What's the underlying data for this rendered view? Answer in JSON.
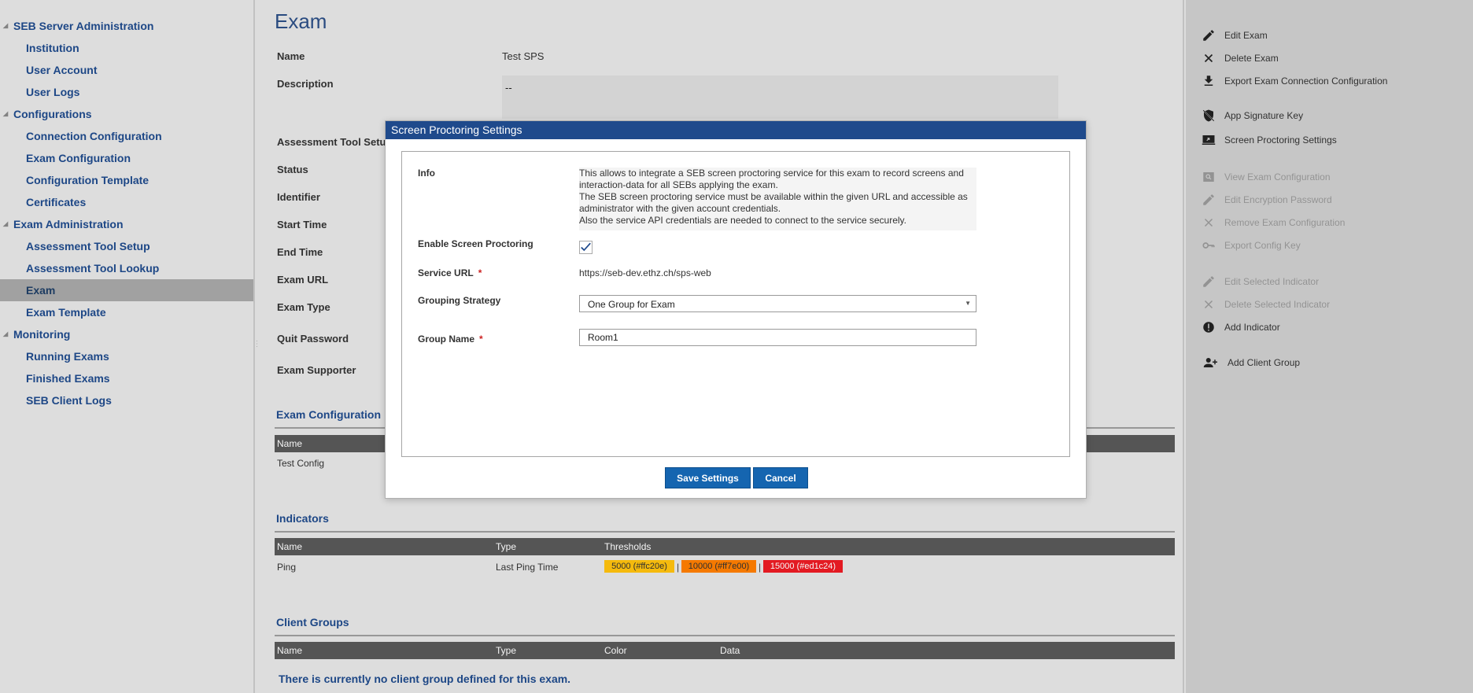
{
  "nav": {
    "groups": [
      {
        "label": "SEB Server Administration",
        "items": [
          "Institution",
          "User Account",
          "User Logs"
        ]
      },
      {
        "label": "Configurations",
        "items": [
          "Connection Configuration",
          "Exam Configuration",
          "Configuration Template",
          "Certificates"
        ]
      },
      {
        "label": "Exam Administration",
        "items": [
          "Assessment Tool Setup",
          "Assessment Tool Lookup",
          "Exam",
          "Exam Template"
        ]
      },
      {
        "label": "Monitoring",
        "items": [
          "Running Exams",
          "Finished Exams",
          "SEB Client Logs"
        ]
      }
    ],
    "active_item": "Exam"
  },
  "main": {
    "title": "Exam",
    "fields": {
      "name_label": "Name",
      "name_value": "Test SPS",
      "description_label": "Description",
      "description_value": "--",
      "assessment_tool_label": "Assessment Tool Setup",
      "status_label": "Status",
      "identifier_label": "Identifier",
      "start_time_label": "Start Time",
      "end_time_label": "End Time",
      "exam_url_label": "Exam URL",
      "exam_type_label": "Exam Type",
      "quit_password_label": "Quit Password",
      "exam_supporter_label": "Exam Supporter"
    },
    "exam_configuration": {
      "title": "Exam Configuration",
      "columns": [
        "Name"
      ],
      "rows": [
        [
          "Test Config"
        ]
      ]
    },
    "indicators": {
      "title": "Indicators",
      "columns": [
        "Name",
        "Type",
        "Thresholds"
      ],
      "rows": [
        {
          "name": "Ping",
          "type": "Last Ping Time",
          "thresholds": [
            {
              "label": "5000 (#ffc20e)",
              "color": "#ffc20e"
            },
            {
              "label": "10000 (#ff7e00)",
              "color": "#ff7e00"
            },
            {
              "label": "15000 (#ed1c24)",
              "color": "#ed1c24"
            }
          ],
          "separator": "|"
        }
      ]
    },
    "client_groups": {
      "title": "Client Groups",
      "columns": [
        "Name",
        "Type",
        "Color",
        "Data"
      ],
      "empty_message": "There is currently no client group defined for this exam."
    }
  },
  "actions": {
    "items": [
      {
        "label": "Edit Exam",
        "icon": "pencil-icon",
        "enabled": true
      },
      {
        "label": "Delete Exam",
        "icon": "close-icon",
        "enabled": true
      },
      {
        "label": "Export Exam Connection Configuration",
        "icon": "download-icon",
        "enabled": true
      },
      {
        "label": "App Signature Key",
        "icon": "shield-off-icon",
        "enabled": true
      },
      {
        "label": "Screen Proctoring Settings",
        "icon": "screen-share-icon",
        "enabled": true
      },
      {
        "label": "View Exam Configuration",
        "icon": "view-icon",
        "enabled": false
      },
      {
        "label": "Edit Encryption Password",
        "icon": "pencil-icon",
        "enabled": false
      },
      {
        "label": "Remove Exam Configuration",
        "icon": "close-icon",
        "enabled": false
      },
      {
        "label": "Export Config Key",
        "icon": "key-icon",
        "enabled": false
      },
      {
        "label": "Edit Selected Indicator",
        "icon": "pencil-icon",
        "enabled": false
      },
      {
        "label": "Delete Selected Indicator",
        "icon": "close-icon",
        "enabled": false
      },
      {
        "label": "Add Indicator",
        "icon": "alert-circle-icon",
        "enabled": true
      },
      {
        "label": "Add Client Group",
        "icon": "add-user-icon",
        "enabled": true
      }
    ]
  },
  "dialog": {
    "title": "Screen Proctoring Settings",
    "info_label": "Info",
    "info_lines": [
      "This allows to integrate a SEB screen proctoring service for this exam to record screens and",
      "interaction-data for all SEBs applying the exam.",
      "The SEB screen proctoring service must be available within the given URL and accessible as",
      "administrator with the given account credentials.",
      "Also the service API credentials are needed to connect to the service securely."
    ],
    "enable_label": "Enable Screen Proctoring",
    "enable_checked": true,
    "service_url_label": "Service URL",
    "service_url_value": "https://seb-dev.ethz.ch/sps-web",
    "grouping_label": "Grouping Strategy",
    "grouping_value": "One Group for Exam",
    "group_name_label": "Group Name",
    "group_name_value": "Room1",
    "required_mark": "*",
    "save_label": "Save Settings",
    "cancel_label": "Cancel"
  },
  "colors": {
    "primary": "#1f4a8c",
    "button": "#1565b0",
    "table_header": "#595959",
    "required": "#cc2222"
  }
}
